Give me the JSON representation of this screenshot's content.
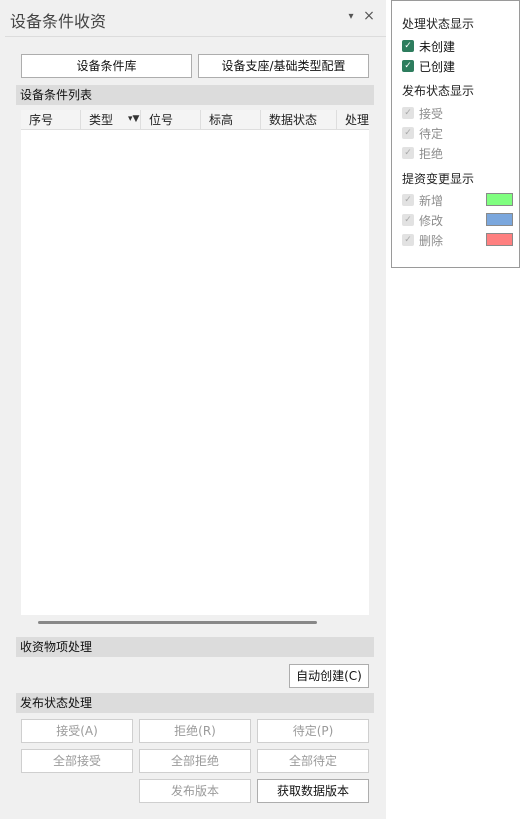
{
  "panel": {
    "title": "设备条件收资",
    "pin_glyph": "▾",
    "close_glyph": "×"
  },
  "toolbar": {
    "library_label": "设备条件库",
    "config_label": "设备支座/基础类型配置"
  },
  "list": {
    "section_title": "设备条件列表",
    "columns": [
      "序号",
      "类型",
      "位号",
      "标高",
      "数据状态",
      "处理状态"
    ],
    "rows": []
  },
  "receive": {
    "section_title": "收资物项处理",
    "auto_create_label": "自动创建(C)"
  },
  "publish": {
    "section_title": "发布状态处理",
    "accept_label": "接受(A)",
    "reject_label": "拒绝(R)",
    "pending_label": "待定(P)",
    "accept_all_label": "全部接受",
    "reject_all_label": "全部拒绝",
    "pending_all_label": "全部待定",
    "publish_version_label": "发布版本",
    "fetch_version_label": "获取数据版本"
  },
  "popup": {
    "process_heading": "处理状态显示",
    "process_options": [
      {
        "label": "未创建",
        "checked": true
      },
      {
        "label": "已创建",
        "checked": true
      }
    ],
    "publish_heading": "发布状态显示",
    "publish_options": [
      {
        "label": "接受",
        "checked": true,
        "enabled": false
      },
      {
        "label": "待定",
        "checked": true,
        "enabled": false
      },
      {
        "label": "拒绝",
        "checked": true,
        "enabled": false
      }
    ],
    "change_heading": "提资变更显示",
    "change_options": [
      {
        "label": "新增",
        "checked": true,
        "enabled": false,
        "color": "#80ff80"
      },
      {
        "label": "修改",
        "checked": true,
        "enabled": false,
        "color": "#7ba7dd"
      },
      {
        "label": "删除",
        "checked": true,
        "enabled": false,
        "color": "#ff8080"
      }
    ]
  },
  "icons": {
    "check": "✓",
    "pin": "pin-icon",
    "close": "close-icon",
    "filter": "filter-icon"
  }
}
